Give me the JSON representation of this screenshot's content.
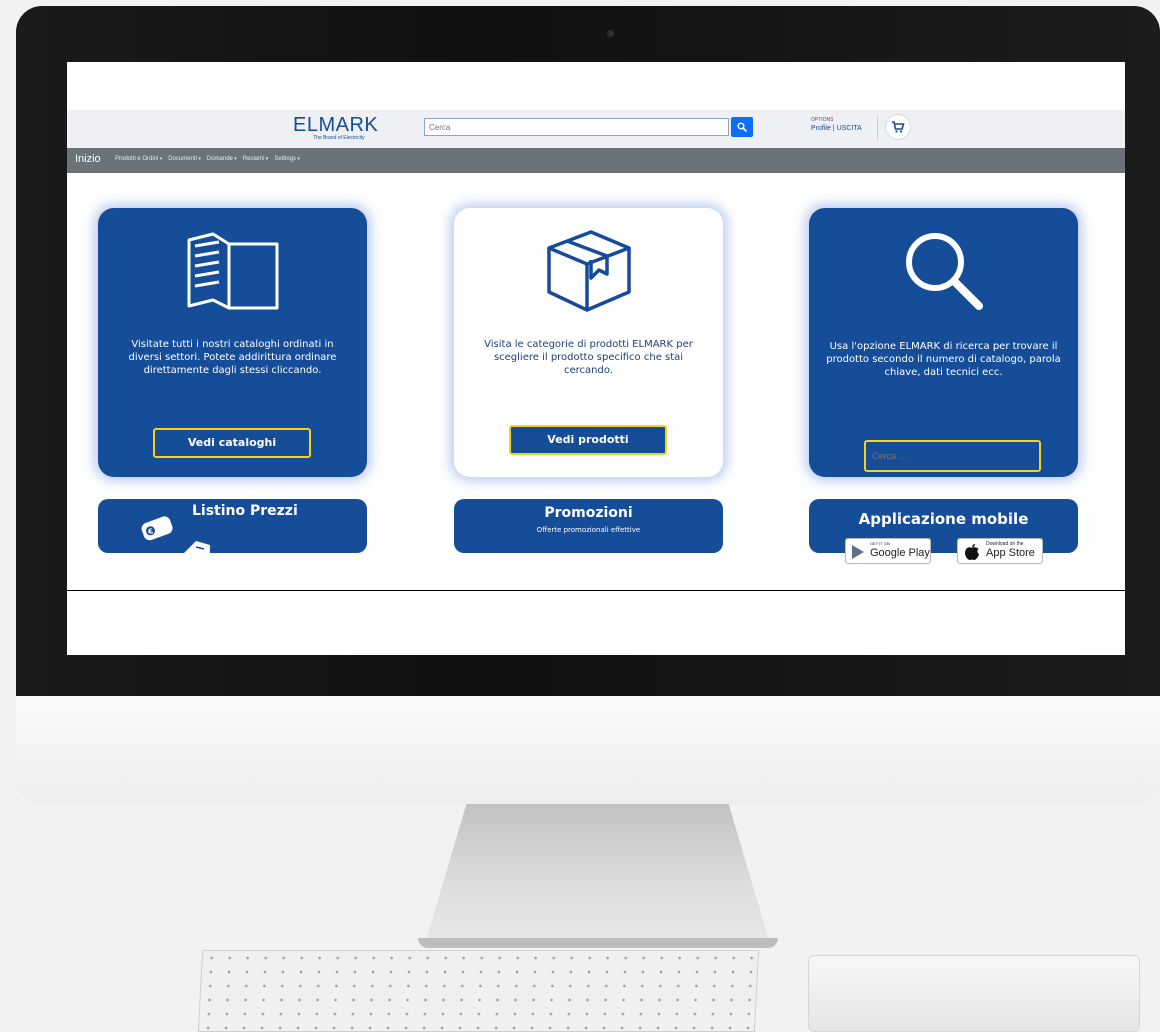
{
  "header": {
    "logo": "ELMARK",
    "logo_tagline": "The Brand of Electricity",
    "search_placeholder": "Cerca",
    "options_title": "OPTIONS",
    "profile_link": "Profile",
    "separator": "|",
    "logout_link": "USCITA"
  },
  "nav": {
    "home": "Inizio",
    "items": [
      "Prodotti e Ordini",
      "Documenti",
      "Domande",
      "Reclami",
      "Settings"
    ]
  },
  "cards": [
    {
      "text": "Visitate tutti i nostri cataloghi ordinati in diversi settori. Potete addirittura ordinare direttamente dagli stessi cliccando.",
      "button": "Vedi cataloghi"
    },
    {
      "text": "Visita le categorie di prodotti ELMARK per scegliere il prodotto specifico che stai cercando.",
      "button": "Vedi prodotti"
    },
    {
      "text": "Usa l'opzione ELMARK di ricerca per trovare il prodotto secondo il numero di catalogo, parola chiave, dati tecnici ecc.",
      "input_placeholder": "Cerca ..."
    }
  ],
  "banners": {
    "pricelist": {
      "title": "Listino Prezzi"
    },
    "promotions": {
      "title": "Promozioni",
      "subtitle": "Offerte promozionali effettive"
    },
    "mobile": {
      "title": "Applicazione mobile",
      "google_top": "GET IT ON",
      "google_bottom": "Google Play",
      "apple_top": "Download on the",
      "apple_bottom": "App Store"
    }
  },
  "colors": {
    "brand_blue": "#154d99",
    "accent_yellow": "#f2d21b",
    "nav_gray": "#6c7378",
    "search_button": "#0c6ef5"
  }
}
